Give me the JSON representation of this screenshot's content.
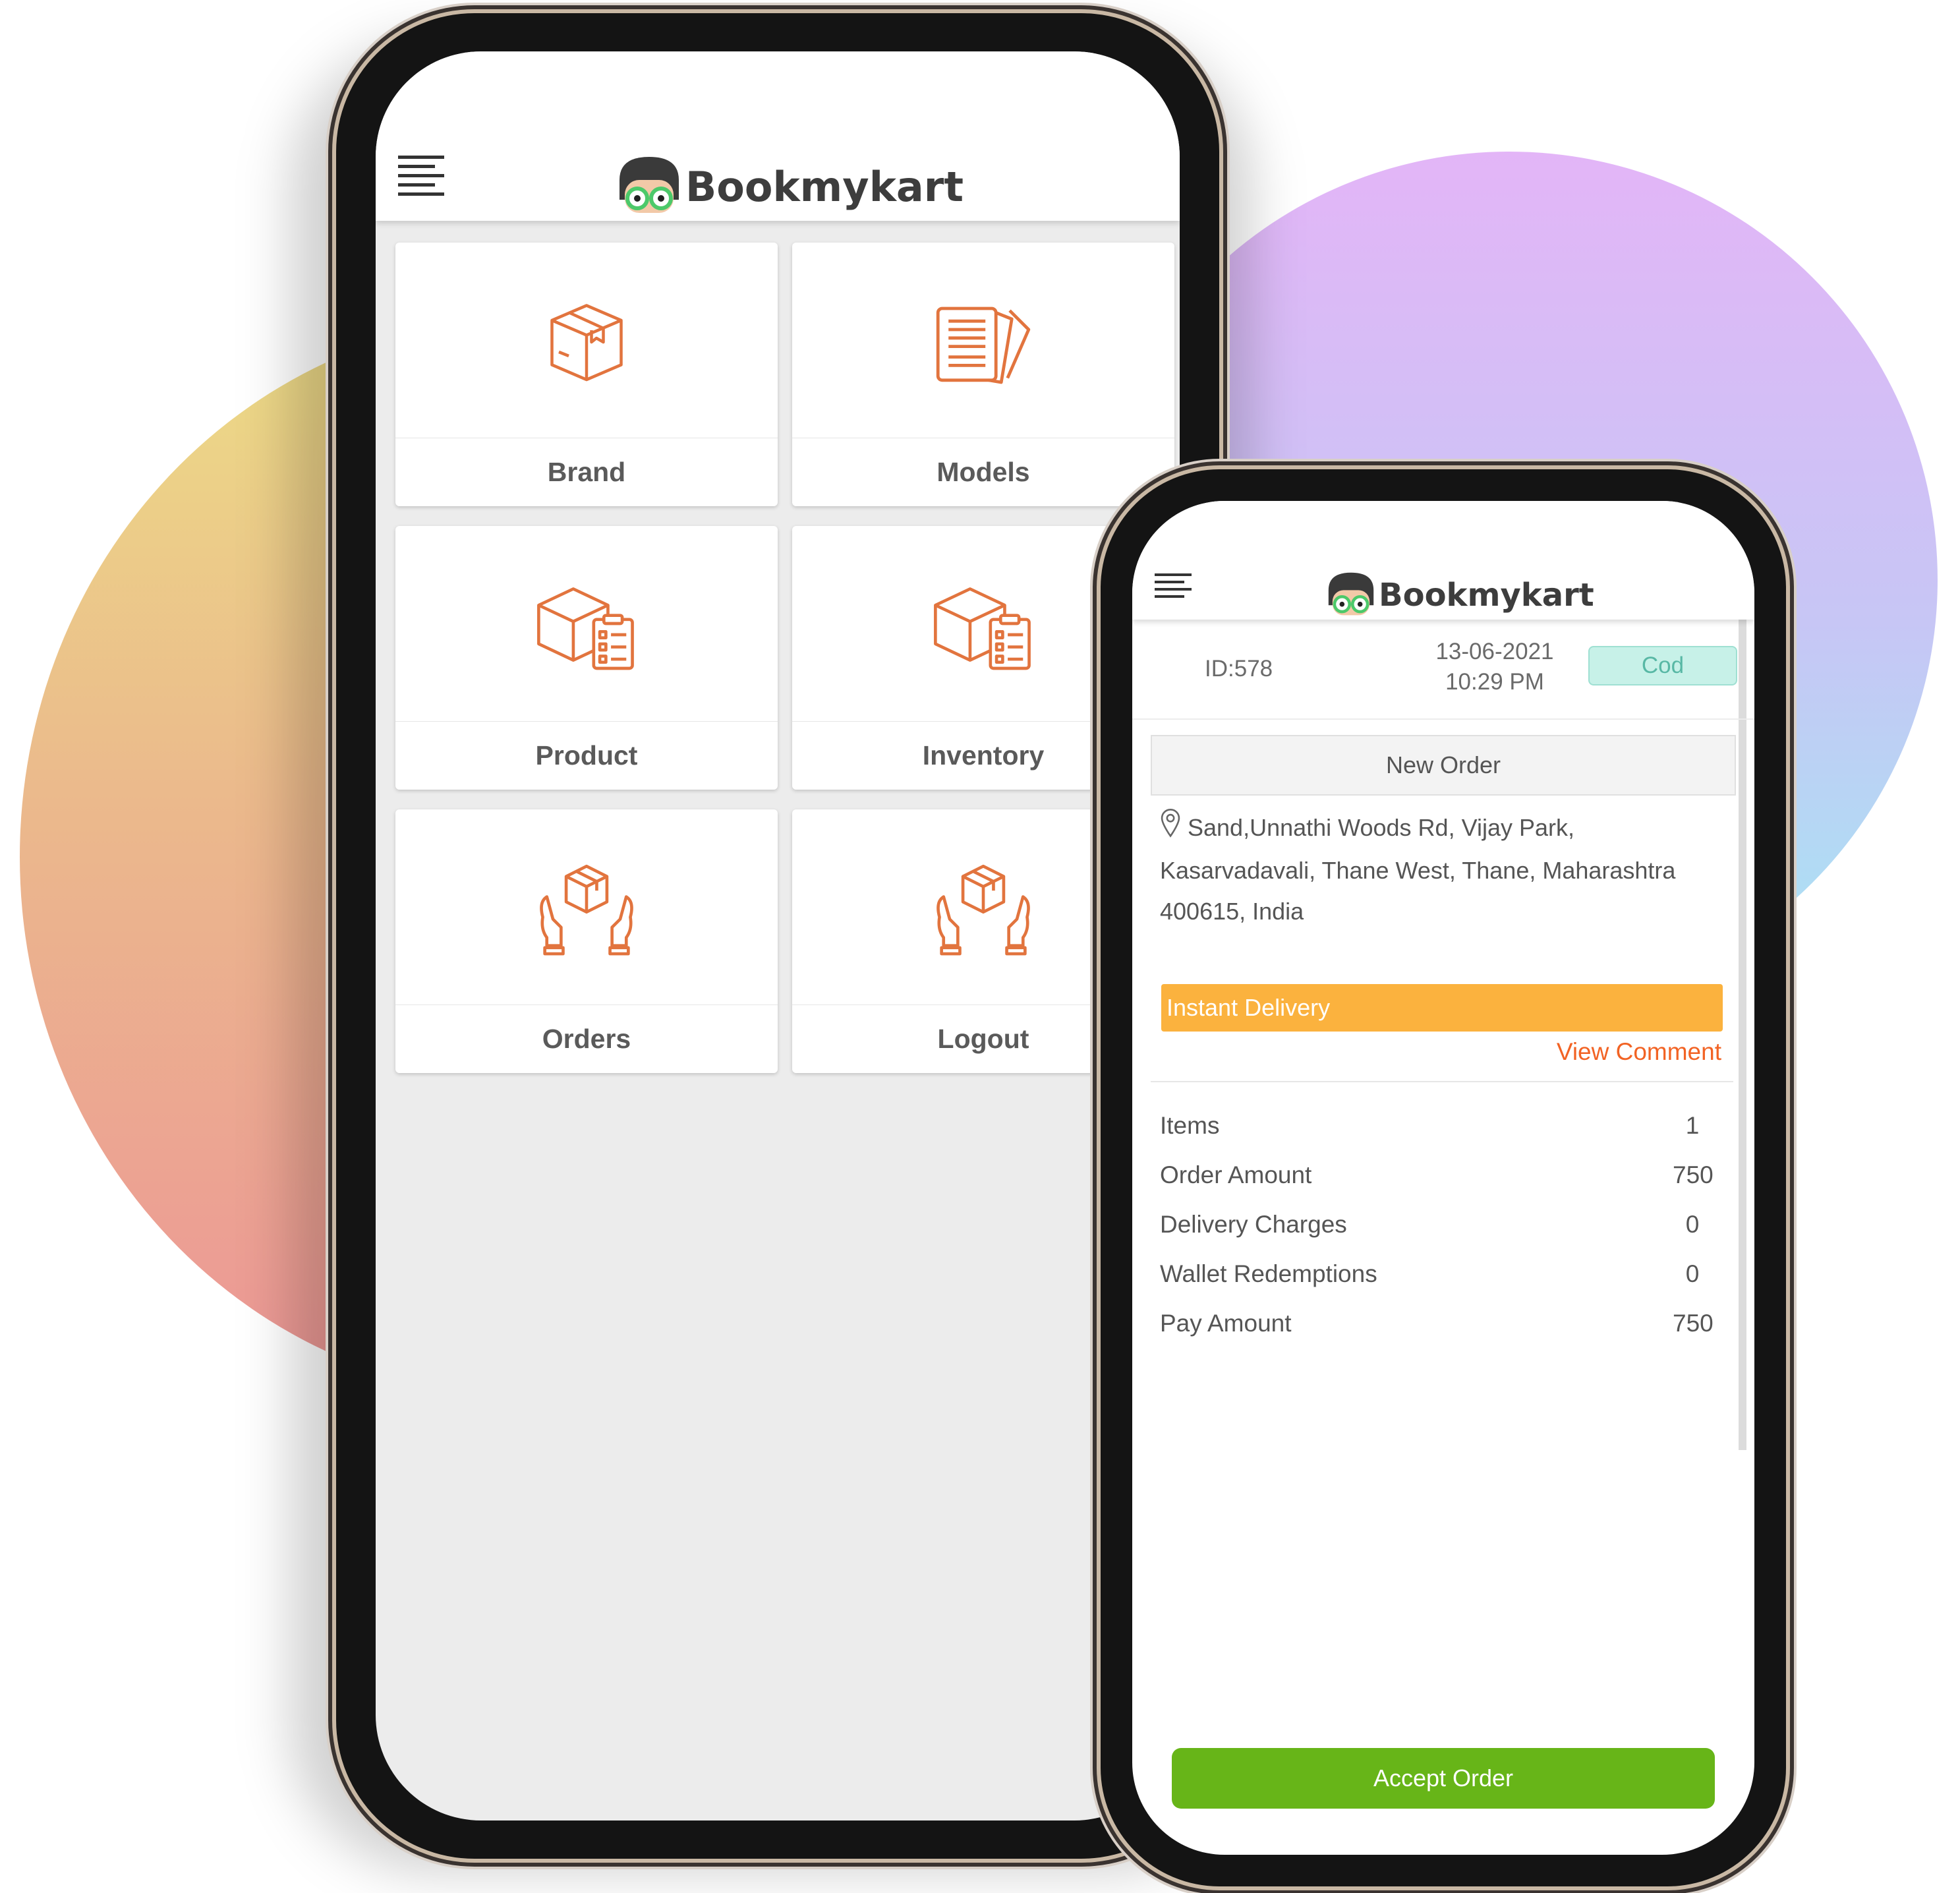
{
  "colors": {
    "accent_orange": "#f26324",
    "icon_orange": "#e2743e",
    "delivery_bar": "#fbb23e",
    "accept_green": "#67b518",
    "cod_badge": "#c7f1e8"
  },
  "app": {
    "brand": "Bookmykart"
  },
  "dashboard": {
    "tiles": [
      {
        "label": "Brand",
        "icon": "box-icon"
      },
      {
        "label": "Models",
        "icon": "documents-icon"
      },
      {
        "label": "Product",
        "icon": "box-checklist-icon"
      },
      {
        "label": "Inventory",
        "icon": "box-checklist-icon"
      },
      {
        "label": "Orders",
        "icon": "hands-box-icon"
      },
      {
        "label": "Logout",
        "icon": "hands-box-icon"
      }
    ]
  },
  "order": {
    "id": "ID:578",
    "date": "13-06-2021",
    "time": "10:29 PM",
    "payment_badge": "Cod",
    "status": "New Order",
    "address": "Sand,Unnathi Woods Rd, Vijay Park, Kasarvadavali, Thane West, Thane, Maharashtra 400615, India",
    "delivery_type": "Instant Delivery",
    "view_comment": "View Comment",
    "summary": [
      {
        "label": "Items",
        "value": "1"
      },
      {
        "label": "Order Amount",
        "value": "750"
      },
      {
        "label": "Delivery Charges",
        "value": "0"
      },
      {
        "label": "Wallet Redemptions",
        "value": "0"
      },
      {
        "label": "Pay Amount",
        "value": "750"
      }
    ],
    "accept_label": "Accept Order"
  }
}
